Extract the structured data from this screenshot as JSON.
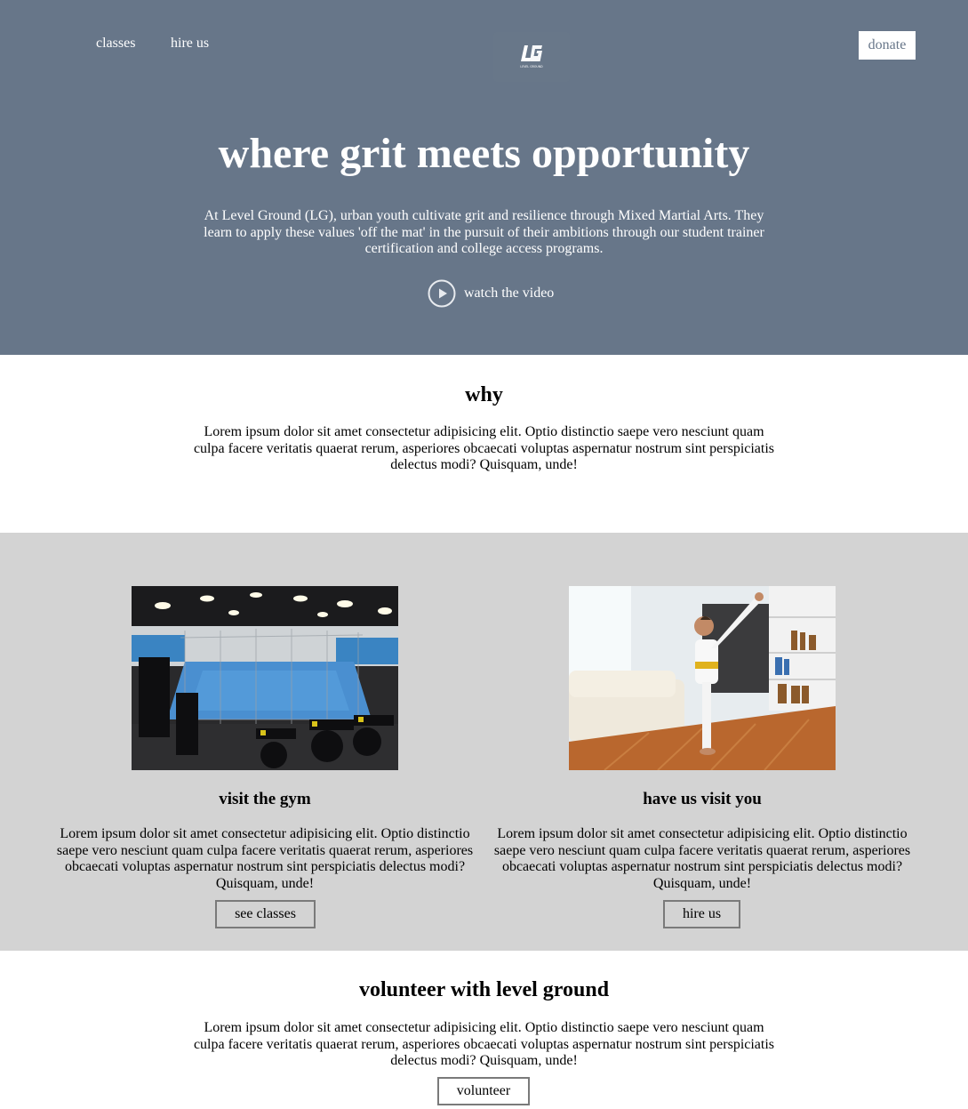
{
  "nav": {
    "classes_label": "classes",
    "hire_label": "hire us",
    "donate_label": "donate",
    "logo_text": "LG",
    "logo_subtext": "LEVEL GROUND"
  },
  "hero": {
    "title": "where grit meets opportunity",
    "description": "At Level Ground (LG), urban youth cultivate grit and resilience through Mixed Martial Arts. They learn to apply these values 'off the mat' in the pursuit of their ambitions through our student trainer certification and college access programs.",
    "video_label": "watch the video",
    "video_icon": "play-circle-icon"
  },
  "why": {
    "title": "why",
    "body": "Lorem ipsum dolor sit amet consectetur adipisicing elit. Optio distinctio saepe vero nesciunt quam culpa facere veritatis quaerat rerum, asperiores obcaecati voluptas aspernatur nostrum sint perspiciatis delectus modi? Quisquam, unde!"
  },
  "cards": [
    {
      "title": "visit the gym",
      "body": "Lorem ipsum dolor sit amet consectetur adipisicing elit. Optio distinctio saepe vero nesciunt quam culpa facere veritatis quaerat rerum, asperiores obcaecati voluptas aspernatur nostrum sint perspiciatis delectus modi? Quisquam, unde!",
      "button_label": "see classes"
    },
    {
      "title": "have us visit you",
      "body": "Lorem ipsum dolor sit amet consectetur adipisicing elit. Optio distinctio saepe vero nesciunt quam culpa facere veritatis quaerat rerum, asperiores obcaecati voluptas aspernatur nostrum sint perspiciatis delectus modi? Quisquam, unde!",
      "button_label": "hire us"
    }
  ],
  "volunteer": {
    "title": "volunteer with level ground",
    "body": "Lorem ipsum dolor sit amet consectetur adipisicing elit. Optio distinctio saepe vero nesciunt quam culpa facere veritatis quaerat rerum, asperiores obcaecati voluptas aspernatur nostrum sint perspiciatis delectus modi? Quisquam, unde!",
    "button_label": "volunteer"
  },
  "colors": {
    "hero_bg": "#677689",
    "cards_bg": "#d3d3d3",
    "page_bg": "#ffffff"
  }
}
